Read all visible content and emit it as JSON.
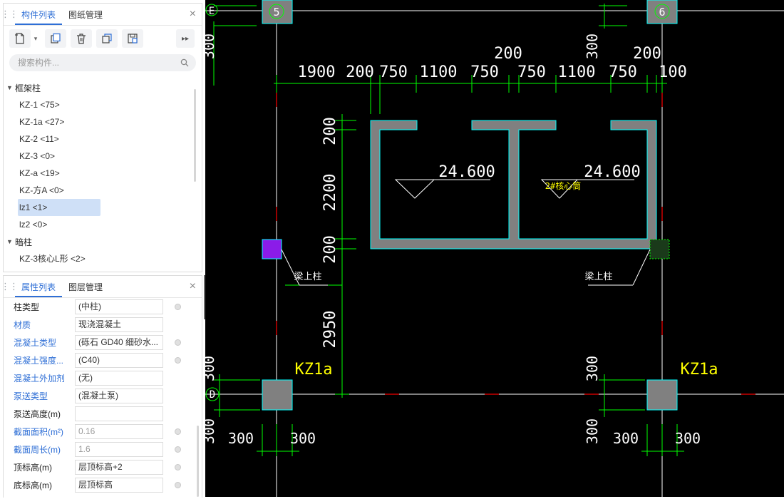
{
  "component_panel": {
    "tabs": [
      "构件列表",
      "图纸管理"
    ],
    "close_label": "×",
    "search_placeholder": "搜索构件...",
    "groups": [
      {
        "name": "框架柱",
        "items": [
          "KZ-1 <75>",
          "KZ-1a <27>",
          "KZ-2 <11>",
          "KZ-3 <0>",
          "KZ-a <19>",
          "KZ-方A <0>",
          "lz1 <1>",
          "lz2 <0>"
        ],
        "selected": "lz1 <1>"
      },
      {
        "name": "暗柱",
        "items": [
          "KZ-3核心L形 <2>"
        ]
      }
    ]
  },
  "property_panel": {
    "tabs": [
      "属性列表",
      "图层管理"
    ],
    "close_label": "×",
    "rows": [
      {
        "label": "柱类型",
        "value": "(中柱)",
        "blue": false,
        "dot": true
      },
      {
        "label": "材质",
        "value": "现浇混凝土",
        "blue": true,
        "dot": false
      },
      {
        "label": "混凝土类型",
        "value": "(砾石 GD40 细砂水...",
        "blue": true,
        "dot": true
      },
      {
        "label": "混凝土强度...",
        "value": "(C40)",
        "blue": true,
        "dot": true
      },
      {
        "label": "混凝土外加剂",
        "value": "(无)",
        "blue": true,
        "dot": false
      },
      {
        "label": "泵送类型",
        "value": "(混凝土泵)",
        "blue": true,
        "dot": false
      },
      {
        "label": "泵送高度(m)",
        "value": "",
        "blue": false,
        "dot": false
      },
      {
        "label": "截面面积(m²)",
        "value": "0.16",
        "blue": true,
        "dot": true,
        "gray": true
      },
      {
        "label": "截面周长(m)",
        "value": "1.6",
        "blue": true,
        "dot": true,
        "gray": true
      },
      {
        "label": "顶标高(m)",
        "value": "层顶标高+2",
        "blue": false,
        "dot": true
      },
      {
        "label": "底标高(m)",
        "value": "层顶标高",
        "blue": false,
        "dot": true
      }
    ]
  },
  "collapse_label": "‹",
  "drawing": {
    "axis_labels": {
      "row_top": "E",
      "row_bottom": "D",
      "col_left": "5",
      "col_right": "6"
    },
    "top_dims_row1": [
      "200",
      "200"
    ],
    "top_dims_row2": [
      "1900",
      "200",
      "750",
      "1100",
      "750",
      "750",
      "1100",
      "750",
      "100"
    ],
    "left_dims": [
      "200",
      "2200",
      "200",
      "2950"
    ],
    "elevation_left": "24.600",
    "elevation_right": "24.600",
    "well_label": "2#核心筒",
    "beam_column_labels": [
      "梁上柱",
      "梁上柱"
    ],
    "column_labels": [
      "KZ1a",
      "KZ1a"
    ],
    "side_dims_left": [
      "300",
      "300",
      "300"
    ],
    "side_dims_right": [
      "300",
      "300",
      "300"
    ],
    "bottom_dims_left": [
      "300",
      "300"
    ],
    "bottom_dims_right": [
      "300",
      "300"
    ],
    "colors": {
      "background": "#000000",
      "dim": "#00ff00",
      "axis": "#ffffff",
      "wall": "#808080",
      "wall_edge": "#00ffff",
      "text": "#ffffff",
      "label": "#ffff00",
      "purple": "#8b1ce8"
    }
  }
}
